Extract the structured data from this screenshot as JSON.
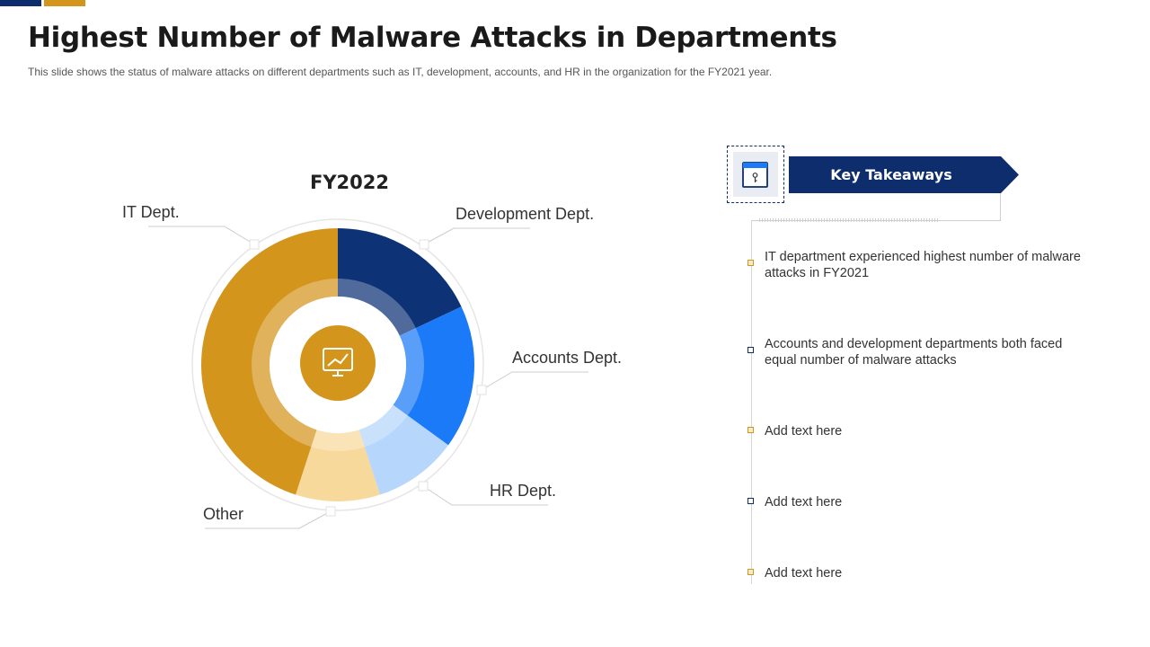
{
  "slide": {
    "title": "Highest Number of Malware Attacks in Departments",
    "subtitle": "This slide shows the status of malware attacks on different departments  such as IT, development,  accounts, and HR in the organization for the FY2021 year."
  },
  "chart_data": {
    "type": "pie",
    "variant": "doughnut",
    "title": "FY2022",
    "slices": [
      {
        "label": "Development Dept.",
        "value": 18,
        "color": "#0d3275"
      },
      {
        "label": "Accounts Dept.",
        "value": 17,
        "color": "#1a7af8"
      },
      {
        "label": "HR Dept.",
        "value": 10,
        "color": "#b6d6fb"
      },
      {
        "label": "Other",
        "value": 10,
        "color": "#f8d99c"
      },
      {
        "label": "IT Dept.",
        "value": 45,
        "color": "#d4951d"
      }
    ],
    "center_icon": "computer-chart-icon"
  },
  "key_takeaways": {
    "heading": "Key Takeaways",
    "icon": "key-document-icon",
    "items": [
      {
        "text": "IT department experienced highest number of malware attacks in FY2021",
        "marker": "gold"
      },
      {
        "text": "Accounts and development departments both faced equal number of malware attacks",
        "marker": "navy"
      },
      {
        "text": "Add text here",
        "marker": "gold"
      },
      {
        "text": "Add text here",
        "marker": "navy"
      },
      {
        "text": "Add text here",
        "marker": "gold"
      }
    ]
  },
  "colors": {
    "navy": "#0d2d6c",
    "gold": "#d4951d"
  }
}
